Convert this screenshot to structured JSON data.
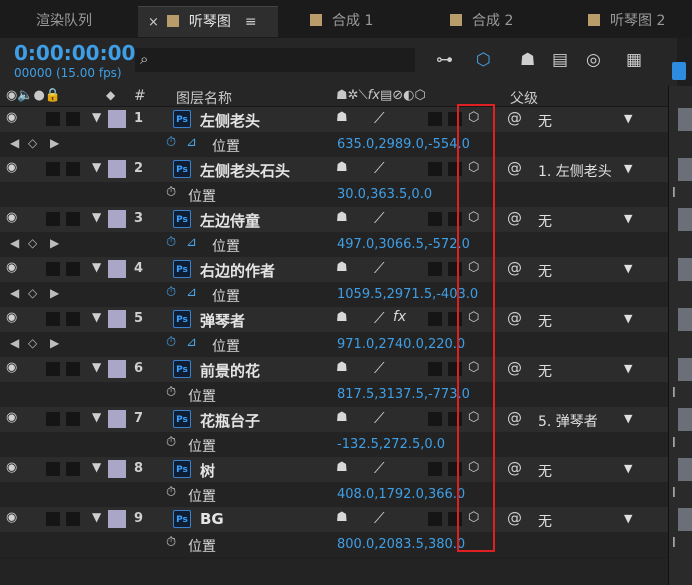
{
  "tabs": [
    {
      "label": "渲染队列",
      "active": false
    },
    {
      "label": "听琴图",
      "active": true
    },
    {
      "label": "合成 1",
      "active": false
    },
    {
      "label": "合成 2",
      "active": false
    },
    {
      "label": "听琴图 2",
      "active": false
    }
  ],
  "tab_close": "×",
  "tab_menu": "≡",
  "timecode": "0:00:00:00",
  "frame_info": "00000 (15.00 fps)",
  "search": {
    "placeholder": ""
  },
  "columns": {
    "number": "#",
    "layer_name": "图层名称",
    "parent": "父级"
  },
  "layers": [
    {
      "num": "1",
      "name": "左侧老头",
      "parent": "无",
      "prop": "位置",
      "value": "635.0,2989.0,-554.0",
      "keyframed": true
    },
    {
      "num": "2",
      "name": "左侧老头石头",
      "parent": "1. 左侧老头",
      "prop": "位置",
      "value": "30.0,363.5,0.0",
      "keyframed": false
    },
    {
      "num": "3",
      "name": "左边侍童",
      "parent": "无",
      "prop": "位置",
      "value": "497.0,3066.5,-572.0",
      "keyframed": true
    },
    {
      "num": "4",
      "name": "右边的作者",
      "parent": "无",
      "prop": "位置",
      "value": "1059.5,2971.5,-403.0",
      "keyframed": true
    },
    {
      "num": "5",
      "name": "弹琴者",
      "parent": "无",
      "prop": "位置",
      "value": "971.0,2740.0,220.0",
      "keyframed": true,
      "fx": true
    },
    {
      "num": "6",
      "name": "前景的花",
      "parent": "无",
      "prop": "位置",
      "value": "817.5,3137.5,-773.0",
      "keyframed": false
    },
    {
      "num": "7",
      "name": "花瓶台子",
      "parent": "5. 弹琴者",
      "prop": "位置",
      "value": "-132.5,272.5,0.0",
      "keyframed": false
    },
    {
      "num": "8",
      "name": "树",
      "parent": "无",
      "prop": "位置",
      "value": "408.0,1792.0,366.0",
      "keyframed": false
    },
    {
      "num": "9",
      "name": "BG",
      "parent": "无",
      "prop": "位置",
      "value": "800.0,2083.5,380.0",
      "keyframed": false
    }
  ],
  "icons": {
    "eye": "eye-icon",
    "stopwatch": "stopwatch-icon",
    "graph": "graph-icon",
    "cube": "3d-layer-icon",
    "pickwhip": "pickwhip-icon",
    "psd": "psd-file-icon"
  },
  "colors": {
    "accent": "#3f9fe6",
    "label": "#a9a6c8",
    "highlight": "#e02020",
    "tab_label": "#b89d6b"
  }
}
